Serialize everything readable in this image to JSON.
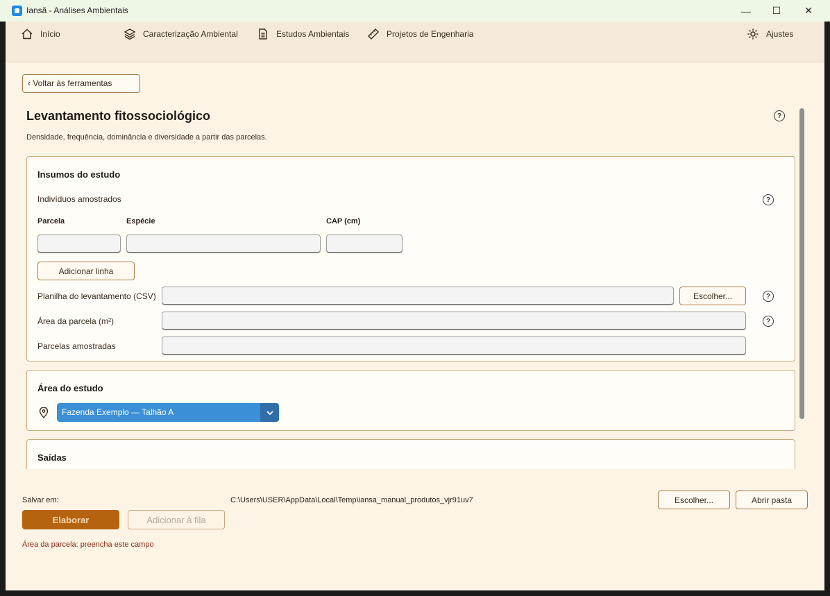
{
  "window": {
    "title": "Iansã - Análises Ambientais",
    "minimize": "—",
    "maximize": "☐",
    "close": "✕"
  },
  "nav": {
    "items": [
      {
        "label": "Início",
        "icon": "home-icon"
      },
      {
        "label": "Caracterização Ambiental",
        "icon": "layers-icon"
      },
      {
        "label": "Estudos Ambientais",
        "icon": "document-icon"
      },
      {
        "label": "Projetos de Engenharia",
        "icon": "ruler-icon"
      }
    ],
    "settings": {
      "label": "Ajustes",
      "icon": "gear-icon"
    }
  },
  "back_button": "‹ Voltar às ferramentas",
  "page": {
    "title": "Levantamento fitossociológico",
    "subtitle": "Densidade, frequência, dominância e diversidade a partir das parcelas."
  },
  "inputs_section": {
    "title": "Insumos do estudo",
    "individuals_label": "Indivíduos amostrados",
    "columns": [
      "Parcela",
      "Espécie",
      "CAP (cm)"
    ],
    "add_row": "Adicionar linha",
    "csv_label": "Planilha do levantamento (CSV)",
    "csv_value": "",
    "choose": "Escolher...",
    "area_label": "Área da parcela (m²)",
    "area_value": "",
    "plots_label": "Parcelas amostradas",
    "plots_value": ""
  },
  "study_area": {
    "title": "Área do estudo",
    "selected": "Fazenda Exemplo — Talhão A"
  },
  "outputs": {
    "title": "Saídas"
  },
  "footer": {
    "save_label": "Salvar em:",
    "save_path": "C:\\Users\\USER\\AppData\\Local\\Temp\\iansa_manual_produtos_vjr91uv7",
    "choose": "Escolher...",
    "open_folder": "Abrir pasta",
    "elaborate": "Elaborar",
    "add_queue": "Adicionar à fila",
    "error": "Área da parcela: preencha este campo"
  },
  "colors": {
    "accent": "#b5630e",
    "select": "#3b8fd6",
    "background": "#fdf4e6",
    "error": "#8a2a12"
  }
}
